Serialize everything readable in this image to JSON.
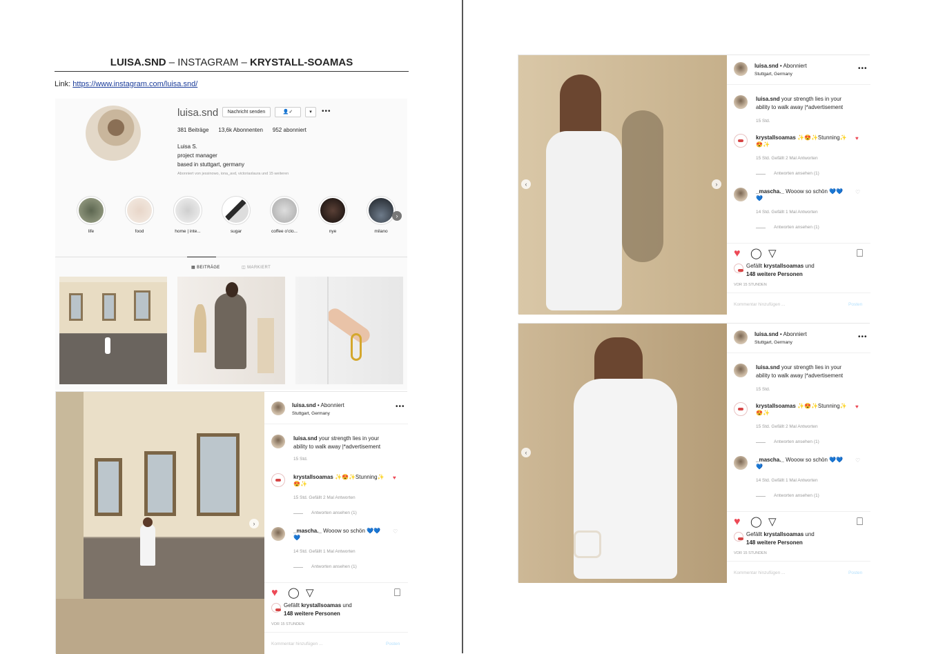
{
  "header": {
    "title_part1": "LUISA.SND",
    "title_part2": " – INSTAGRAM – ",
    "title_part3": "KRYSTALL-SOAMAS",
    "link_label": "Link: ",
    "link_url": "https://www.instagram.com/luisa.snd/"
  },
  "profile": {
    "username": "luisa.snd",
    "message_button": "Nachricht senden",
    "follow_icon": "person-check-icon",
    "dropdown_icon": "chevron-down-icon",
    "more": "•••",
    "posts": "381",
    "posts_label": "Beiträge",
    "followers": "13,6k",
    "followers_label": "Abonnenten",
    "following": "952",
    "following_label": "abonniert",
    "name": "Luisa S.",
    "bio_line1": "project manager",
    "bio_line2": "based in stuttgart, germany",
    "followed_by": "Abonniert von jessinowo, iona_avd, victoriaxlaura und 15 weiteren",
    "highlights": [
      "life",
      "food",
      "home | inte...",
      "sugar",
      "coffee o'clo...",
      "nye",
      "milano"
    ],
    "tab_posts": "BEITRÄGE",
    "tab_tagged": "MARKIERT"
  },
  "post": {
    "user": "luisa.snd",
    "follow_state": "• Abonniert",
    "location": "Stuttgart, Germany",
    "more": "•••",
    "caption_user": "luisa.snd",
    "caption_line1": " your strength lies in your",
    "caption_line2": "ability to walk away |*advertisement",
    "caption_time": "15 Std.",
    "c1_user": "krystallsoamas",
    "c1_text": " ✨😍✨Stunning✨",
    "c1_text2": "😍✨",
    "c1_meta": "15 Std.     Gefällt 2 Mal     Antworten",
    "c1_replies": "Antworten ansehen (1)",
    "c2_user": "_mascha._",
    "c2_text": " Wooow so schön 💙💙",
    "c2_text2": "💙",
    "c2_meta": "14 Std.     Gefällt 1 Mal     Antworten",
    "c2_replies": "Antworten ansehen (1)",
    "likes_prefix": "Gefällt ",
    "likes_user": "krystallsoamas",
    "likes_suffix": " und",
    "likes_others": "148 weitere Personen",
    "time_ago": "VOR 15 STUNDEN",
    "comment_placeholder": "Kommentar hinzufügen ...",
    "post_button": "Posten"
  },
  "colors": {
    "heart": "#ed4956",
    "link": "#1a3c9a",
    "post_button": "#b2dffc"
  }
}
